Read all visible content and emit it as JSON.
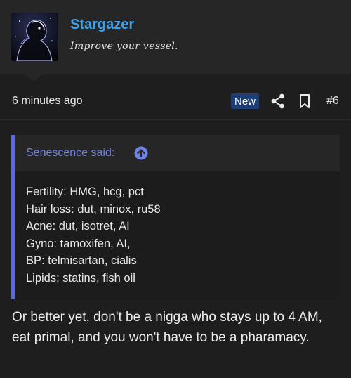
{
  "author": {
    "username": "Stargazer",
    "user_title": "Improve your vessel."
  },
  "post_meta": {
    "timestamp": "6 minutes ago",
    "badge": "New",
    "post_number": "#6",
    "icons": [
      "share-icon",
      "bookmark-icon"
    ]
  },
  "quote": {
    "author_line": "Senescence said:",
    "lines": [
      "Fertility: HMG, hcg, pct",
      "Hair loss: dut, minox, ru58",
      "Acne: dut, isotret, AI",
      "Gyno: tamoxifen, AI,",
      "BP: telmisartan, cialis",
      "Lipids: statins, fish oil"
    ]
  },
  "reply_text": "Or better yet, don't be a nigga who stays up to 4 AM, eat primal, and you won't have to be a pharamacy.",
  "colors": {
    "username": "#3ea2ea",
    "badge_bg": "#1f3e78",
    "quote_bar": "#5b6dd0",
    "quote_author": "#6f84e8",
    "background": "#1e1e1f"
  }
}
